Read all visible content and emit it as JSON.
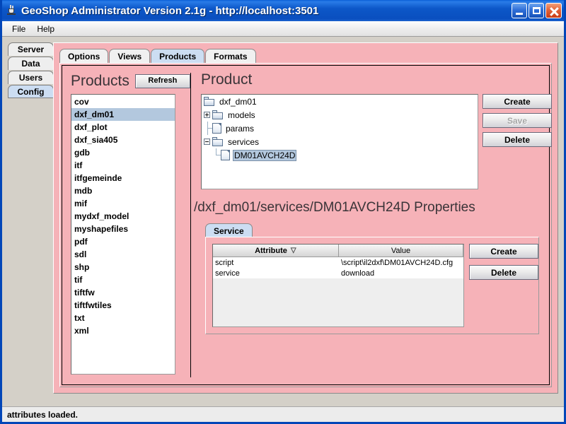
{
  "window": {
    "title": "GeoShop Administrator Version 2.1g - http://localhost:3501",
    "icon": "java-coffee-cup-icon",
    "minimize_label": "",
    "maximize_label": "",
    "close_label": ""
  },
  "menubar": {
    "items": [
      {
        "label": "File"
      },
      {
        "label": "Help"
      }
    ]
  },
  "vertical_tabs": {
    "items": [
      {
        "label": "Server",
        "selected": false
      },
      {
        "label": "Data",
        "selected": false
      },
      {
        "label": "Users",
        "selected": false
      },
      {
        "label": "Config",
        "selected": true
      }
    ]
  },
  "horizontal_tabs": {
    "items": [
      {
        "label": "Options",
        "selected": false
      },
      {
        "label": "Views",
        "selected": false
      },
      {
        "label": "Products",
        "selected": true
      },
      {
        "label": "Formats",
        "selected": false
      }
    ]
  },
  "products_panel": {
    "title": "Products",
    "refresh_label": "Refresh",
    "items": [
      {
        "label": "cov",
        "selected": false
      },
      {
        "label": "dxf_dm01",
        "selected": true
      },
      {
        "label": "dxf_plot",
        "selected": false
      },
      {
        "label": "dxf_sia405",
        "selected": false
      },
      {
        "label": "gdb",
        "selected": false
      },
      {
        "label": "itf",
        "selected": false
      },
      {
        "label": "itfgemeinde",
        "selected": false
      },
      {
        "label": "mdb",
        "selected": false
      },
      {
        "label": "mif",
        "selected": false
      },
      {
        "label": "mydxf_model",
        "selected": false
      },
      {
        "label": "myshapefiles",
        "selected": false
      },
      {
        "label": "pdf",
        "selected": false
      },
      {
        "label": "sdl",
        "selected": false
      },
      {
        "label": "shp",
        "selected": false
      },
      {
        "label": "tif",
        "selected": false
      },
      {
        "label": "tiftfw",
        "selected": false
      },
      {
        "label": "tiftfwtiles",
        "selected": false
      },
      {
        "label": "txt",
        "selected": false
      },
      {
        "label": "xml",
        "selected": false
      }
    ]
  },
  "product_panel": {
    "title": "Product",
    "tree": [
      {
        "label": "dxf_dm01",
        "depth": 0,
        "icon": "folder-icon",
        "handle": "none",
        "selected": false
      },
      {
        "label": "models",
        "depth": 1,
        "icon": "folder-icon",
        "handle": "plus",
        "selected": false
      },
      {
        "label": "params",
        "depth": 1,
        "icon": "file-icon",
        "handle": "none",
        "selected": false
      },
      {
        "label": "services",
        "depth": 1,
        "icon": "folder-icon",
        "handle": "minus",
        "selected": false
      },
      {
        "label": "DM01AVCH24D",
        "depth": 2,
        "icon": "file-icon",
        "handle": "none",
        "selected": true
      }
    ],
    "buttons": [
      {
        "label": "Create",
        "enabled": true
      },
      {
        "label": "Save",
        "enabled": false
      },
      {
        "label": "Delete",
        "enabled": true
      }
    ]
  },
  "properties_panel": {
    "title": "/dxf_dm01/services/DM01AVCH24D Properties",
    "tab_label": "Service",
    "table": {
      "columns": [
        {
          "label": "Attribute",
          "sort": "descending"
        },
        {
          "label": "Value",
          "sort": "none"
        }
      ],
      "rows": [
        {
          "attribute": "script",
          "value": "\\script\\il2dxf\\DM01AVCH24D.cfg"
        },
        {
          "attribute": "service",
          "value": "download"
        }
      ]
    },
    "buttons": [
      {
        "label": "Create",
        "enabled": true
      },
      {
        "label": "Delete",
        "enabled": true
      }
    ]
  },
  "statusbar": {
    "message": "attributes loaded."
  },
  "colors": {
    "titlebar_blue": "#0c57c8",
    "panel_pink": "#f6b2b8",
    "selection_blue": "#b3c8de",
    "tab_selected": "#ccddf2",
    "desktop_gray": "#d4d0c8"
  }
}
